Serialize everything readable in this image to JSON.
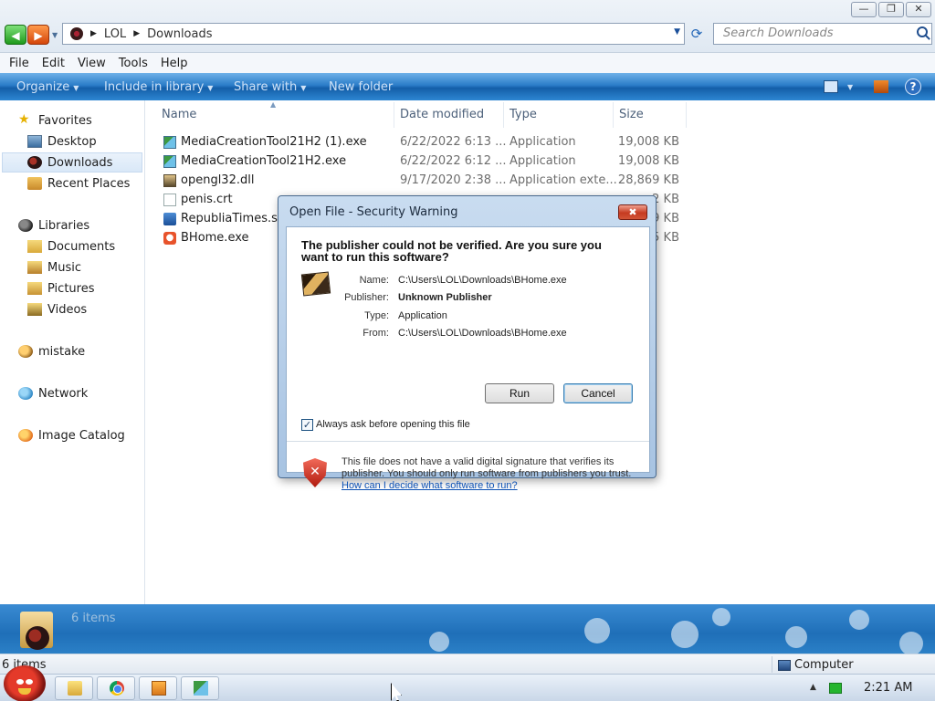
{
  "window": {
    "controls": [
      "minimize",
      "restore",
      "close"
    ]
  },
  "address": {
    "path": [
      "LOL",
      "Downloads"
    ],
    "search_placeholder": "Search Downloads"
  },
  "menu": [
    "File",
    "Edit",
    "View",
    "Tools",
    "Help"
  ],
  "commands": {
    "organize": "Organize",
    "include_in_library": "Include in library",
    "share_with": "Share with",
    "new_folder": "New folder"
  },
  "nav": {
    "favorites": "Favorites",
    "desktop": "Desktop",
    "downloads": "Downloads",
    "recent_places": "Recent Places",
    "libraries": "Libraries",
    "documents": "Documents",
    "music": "Music",
    "pictures": "Pictures",
    "videos": "Videos",
    "mistake": "mistake",
    "network": "Network",
    "image_catalog": "Image Catalog"
  },
  "columns": {
    "name": "Name",
    "date_modified": "Date modified",
    "type": "Type",
    "size": "Size"
  },
  "files": [
    {
      "name": "MediaCreationTool21H2 (1).exe",
      "date": "6/22/2022 6:13 ...",
      "type": "Application",
      "size": "19,008 KB",
      "icon": "setup-icon"
    },
    {
      "name": "MediaCreationTool21H2.exe",
      "date": "6/22/2022 6:12 ...",
      "type": "Application",
      "size": "19,008 KB",
      "icon": "setup-icon"
    },
    {
      "name": "opengl32.dll",
      "date": "9/17/2020 2:38 ...",
      "type": "Application exte...",
      "size": "28,869 KB",
      "icon": "dll-icon"
    },
    {
      "name": "penis.crt",
      "date": "",
      "type": "",
      "size": "2 KB",
      "icon": "certificate-icon"
    },
    {
      "name": "RepubliaTimes.swf",
      "date": "",
      "type": "",
      "size": "9 KB",
      "icon": "flash-icon"
    },
    {
      "name": "BHome.exe",
      "date": "",
      "type": "",
      "size": "5 KB",
      "icon": "bhome-icon"
    }
  ],
  "details": {
    "count": "6 items"
  },
  "status": {
    "count": "6 items",
    "location": "Computer"
  },
  "taskbar": {
    "time": "2:21 AM"
  },
  "dialog": {
    "title": "Open File - Security Warning",
    "heading": "The publisher could not be verified.  Are you sure you want to run this software?",
    "fields": {
      "name_label": "Name:",
      "name_value": "C:\\Users\\LOL\\Downloads\\BHome.exe",
      "publisher_label": "Publisher:",
      "publisher_value": "Unknown Publisher",
      "type_label": "Type:",
      "type_value": "Application",
      "from_label": "From:",
      "from_value": "C:\\Users\\LOL\\Downloads\\BHome.exe"
    },
    "run_label": "Run",
    "cancel_label": "Cancel",
    "checkbox_label": "Always ask before opening this file",
    "checkbox_checked": true,
    "warning_text": "This file does not have a valid digital signature that verifies its publisher.  You should only run software from publishers you trust.",
    "link_text": "How can I decide what software to run?"
  }
}
